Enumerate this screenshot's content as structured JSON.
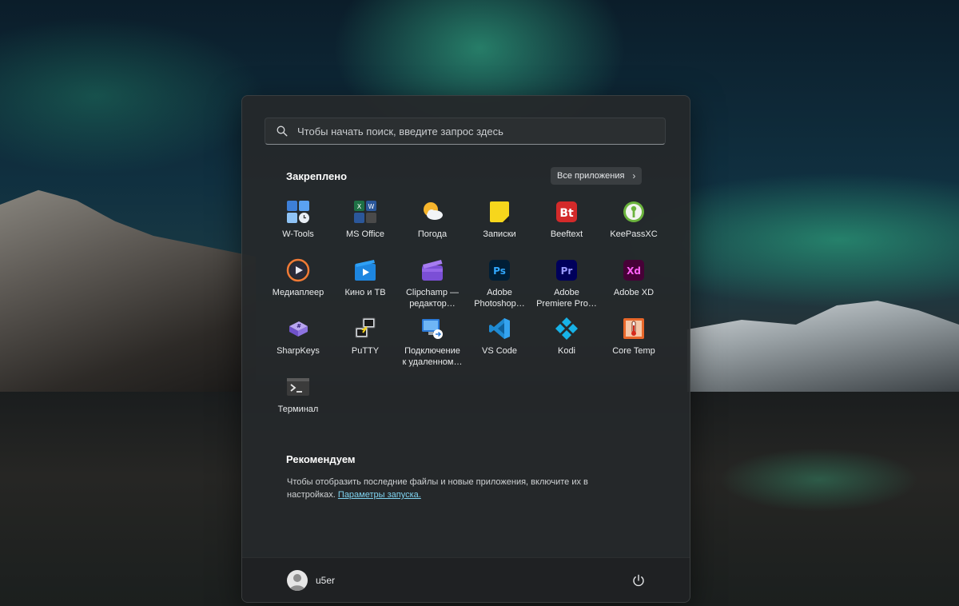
{
  "search": {
    "placeholder": "Чтобы начать поиск, введите запрос здесь"
  },
  "pinned": {
    "title": "Закреплено",
    "all_apps_label": "Все приложения",
    "apps": [
      {
        "label": "W-Tools",
        "icon": "w-tools-icon"
      },
      {
        "label": "MS Office",
        "icon": "ms-office-icon"
      },
      {
        "label": "Погода",
        "icon": "weather-icon"
      },
      {
        "label": "Записки",
        "icon": "sticky-notes-icon"
      },
      {
        "label": "Beeftext",
        "icon": "beeftext-icon"
      },
      {
        "label": "KeePassXC",
        "icon": "keepassxc-icon"
      },
      {
        "label": "Медиаплеер",
        "icon": "media-player-icon"
      },
      {
        "label": "Кино и ТВ",
        "icon": "movies-tv-icon"
      },
      {
        "label": "Clipchamp —\nредактор…",
        "icon": "clipchamp-icon"
      },
      {
        "label": "Adobe\nPhotoshop…",
        "icon": "photoshop-icon"
      },
      {
        "label": "Adobe\nPremiere Pro…",
        "icon": "premiere-pro-icon"
      },
      {
        "label": "Adobe XD",
        "icon": "adobe-xd-icon"
      },
      {
        "label": "SharpKeys",
        "icon": "sharpkeys-icon"
      },
      {
        "label": "PuTTY",
        "icon": "putty-icon"
      },
      {
        "label": "Подключение\nк удаленном…",
        "icon": "remote-desktop-icon"
      },
      {
        "label": "VS Code",
        "icon": "vscode-icon"
      },
      {
        "label": "Kodi",
        "icon": "kodi-icon"
      },
      {
        "label": "Core Temp",
        "icon": "core-temp-icon"
      },
      {
        "label": "Терминал",
        "icon": "terminal-icon"
      }
    ]
  },
  "recommended": {
    "title": "Рекомендуем",
    "text": "Чтобы отобразить последние файлы и новые приложения, включите их в настройках.",
    "link": "Параметры запуска."
  },
  "footer": {
    "user_name": "u5er"
  },
  "colors": {
    "menu_bg": "#25282a",
    "link": "#7fd3f0"
  }
}
